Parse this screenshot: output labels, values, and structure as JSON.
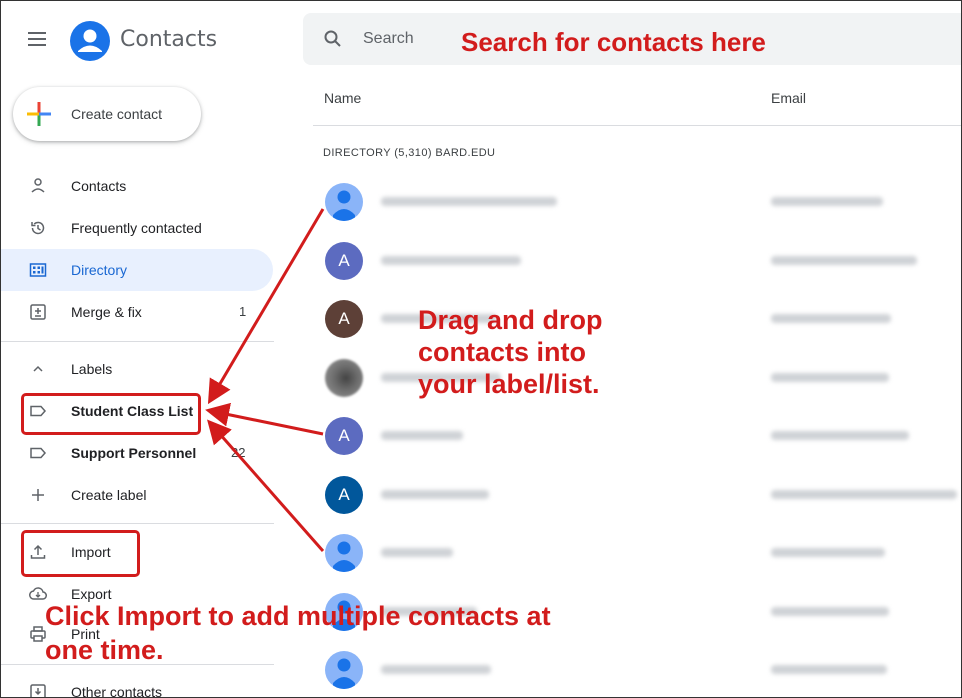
{
  "header": {
    "app_title": "Contacts",
    "search_placeholder": "Search"
  },
  "annotations": {
    "search": "Search for contacts here",
    "drag": "Drag and drop contacts into your label/list.",
    "import": "Click Import to add multiple contacts at one time."
  },
  "sidebar": {
    "create_label": "Create contact",
    "nav": [
      {
        "label": "Contacts",
        "icon": "person-icon"
      },
      {
        "label": "Frequently contacted",
        "icon": "history-icon"
      },
      {
        "label": "Directory",
        "icon": "directory-icon",
        "active": true
      },
      {
        "label": "Merge & fix",
        "icon": "merge-icon",
        "count": "1"
      }
    ],
    "labels_header": "Labels",
    "labels": [
      {
        "label": "Student Class List",
        "icon": "label-icon"
      },
      {
        "label": "Support Personnel",
        "icon": "label-icon",
        "count": "22"
      }
    ],
    "create_label_item": "Create label",
    "tools": [
      {
        "label": "Import",
        "icon": "upload-icon"
      },
      {
        "label": "Export",
        "icon": "cloud-download-icon"
      },
      {
        "label": "Print",
        "icon": "print-icon"
      }
    ],
    "other_contacts": "Other contacts"
  },
  "main": {
    "columns": [
      "Name",
      "Email"
    ],
    "directory_label": "DIRECTORY (5,310) BARD.EDU",
    "rows": [
      {
        "avatar": "person",
        "color": "#8ab4f8"
      },
      {
        "avatar": "letter",
        "letter": "A",
        "color": "#5c6bc0"
      },
      {
        "avatar": "letter",
        "letter": "A",
        "color": "#5d4037"
      },
      {
        "avatar": "photo",
        "color": "#6b6b6b"
      },
      {
        "avatar": "letter",
        "letter": "A",
        "color": "#5c6bc0"
      },
      {
        "avatar": "letter",
        "letter": "A",
        "color": "#01579b"
      },
      {
        "avatar": "person",
        "color": "#8ab4f8"
      },
      {
        "avatar": "person",
        "color": "#8ab4f8"
      },
      {
        "avatar": "person",
        "color": "#8ab4f8"
      }
    ]
  },
  "colors": {
    "annotation": "#d21c1c",
    "accent": "#1a73e8",
    "active_bg": "#e8f0fe"
  }
}
